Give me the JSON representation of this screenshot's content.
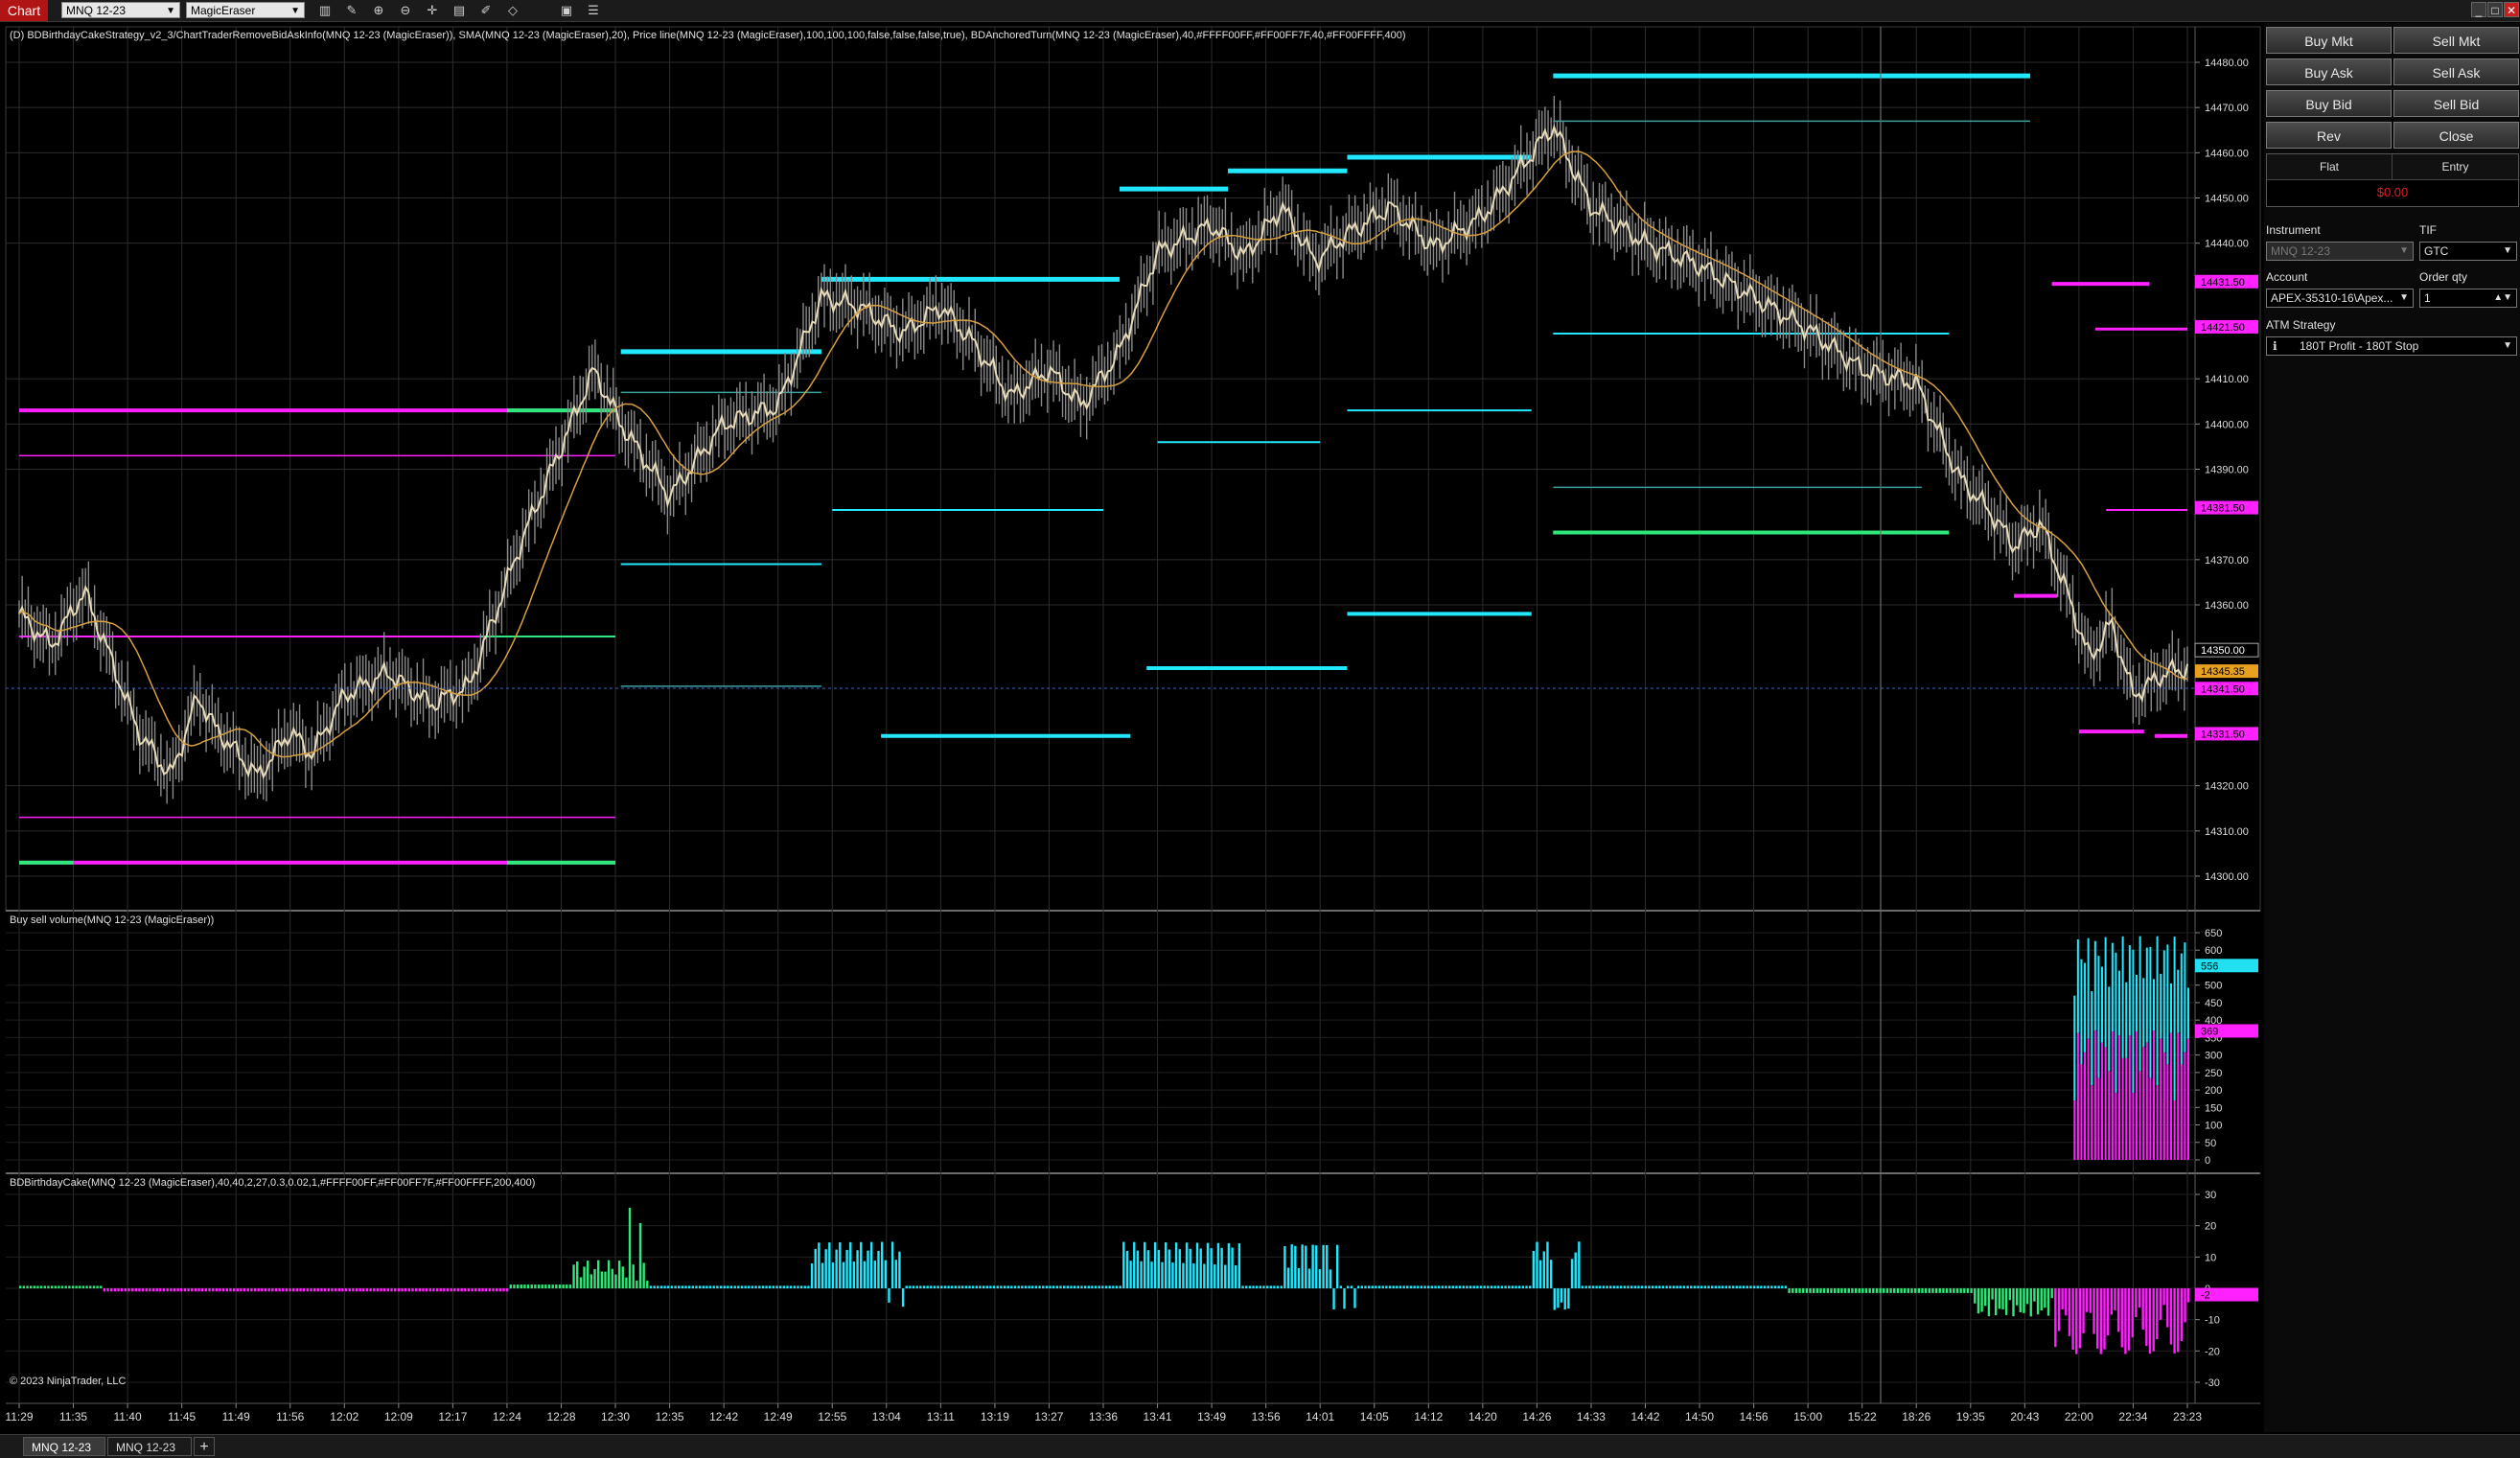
{
  "topbar": {
    "chart_tab": "Chart",
    "instrument": "MNQ 12-23",
    "template": "MagicEraser",
    "icons": [
      "bar-chart-icon",
      "pencil-icon",
      "zoom-in-icon",
      "zoom-out-icon",
      "crosshair-icon",
      "properties-icon",
      "drawing-tools-icon",
      "strategies-icon",
      "data-box-icon",
      "list-icon"
    ],
    "window_buttons": [
      "minimize-icon",
      "maximize-icon",
      "close-icon"
    ]
  },
  "panels": {
    "price": {
      "label": "(D) BDBirthdayCakeStrategy_v2_3/ChartTraderRemoveBidAskInfo(MNQ 12-23 (MagicEraser)), SMA(MNQ 12-23 (MagicEraser),20), Price line(MNQ 12-23 (MagicEraser),100,100,100,false,false,false,true), BDAnchoredTurn(MNQ 12-23 (MagicEraser),40,#FFFF00FF,#FF00FF7F,40,#FF00FFFF,400)",
      "y_ticks": [
        "14480.00",
        "14470.00",
        "14460.00",
        "14450.00",
        "14440.00",
        "14410.00",
        "14400.00",
        "14390.00",
        "14370.00",
        "14360.00",
        "14320.00",
        "14310.00",
        "14300.00"
      ],
      "markers": [
        {
          "text": "14431.50",
          "color": "#ff22ff"
        },
        {
          "text": "14421.50",
          "color": "#ff22ff"
        },
        {
          "text": "14381.50",
          "color": "#ff22ff"
        },
        {
          "text": "14350.00",
          "color": "#000000"
        },
        {
          "text": "14345.35",
          "color": "#e8a020"
        },
        {
          "text": "14341.50",
          "color": "#ff22ff"
        },
        {
          "text": "14331.50",
          "color": "#ff22ff"
        }
      ]
    },
    "volume": {
      "label": "Buy sell volume(MNQ 12-23 (MagicEraser))",
      "y_ticks": [
        "650",
        "600",
        "500",
        "450",
        "400",
        "350",
        "300",
        "250",
        "200",
        "150",
        "100",
        "50",
        "0"
      ],
      "markers": [
        {
          "text": "556",
          "color": "#22e0f0"
        },
        {
          "text": "369",
          "color": "#ff22ff"
        }
      ]
    },
    "cake": {
      "label": "BDBirthdayCake(MNQ 12-23 (MagicEraser),40,40,2,27,0.3,0.02,1,#FFFF00FF,#FF00FF7F,#FF00FFFF,200,400)",
      "y_ticks": [
        "30",
        "20",
        "10",
        "0",
        "-10",
        "-20",
        "-30"
      ],
      "markers": [
        {
          "text": "-2",
          "color": "#ff22ff"
        }
      ]
    },
    "copyright": "© 2023 NinjaTrader, LLC"
  },
  "x_axis": [
    "11:29",
    "11:35",
    "11:40",
    "11:45",
    "11:49",
    "11:56",
    "12:02",
    "12:09",
    "12:17",
    "12:24",
    "12:28",
    "12:30",
    "12:35",
    "12:42",
    "12:49",
    "12:55",
    "13:04",
    "13:11",
    "13:19",
    "13:27",
    "13:36",
    "13:41",
    "13:49",
    "13:56",
    "14:01",
    "14:05",
    "14:12",
    "14:20",
    "14:26",
    "14:33",
    "14:42",
    "14:50",
    "14:56",
    "15:00",
    "15:22",
    "18:26",
    "19:35",
    "20:43",
    "22:00",
    "22:34",
    "23:23"
  ],
  "chart_trader": {
    "buttons": [
      [
        "Buy Mkt",
        "Sell Mkt"
      ],
      [
        "Buy Ask",
        "Sell Ask"
      ],
      [
        "Buy Bid",
        "Sell Bid"
      ],
      [
        "Rev",
        "Close"
      ]
    ],
    "position": {
      "flat": "Flat",
      "entry": "Entry",
      "pnl": "$0.00"
    },
    "instrument_label": "Instrument",
    "instrument_value": "MNQ 12-23",
    "tif_label": "TIF",
    "tif_value": "GTC",
    "account_label": "Account",
    "account_value": "APEX-35310-16\\Apex...",
    "qty_label": "Order qty",
    "qty_value": "1",
    "atm_label": "ATM Strategy",
    "atm_value": "180T Profit - 180T Stop"
  },
  "bottom_tabs": [
    "MNQ 12-23",
    "MNQ 12-23"
  ],
  "colors": {
    "cyan": "#22e8ff",
    "magenta": "#ff20ff",
    "green": "#2ee87a",
    "sma": "#d8a040",
    "grid": "#2c2c2c"
  }
}
